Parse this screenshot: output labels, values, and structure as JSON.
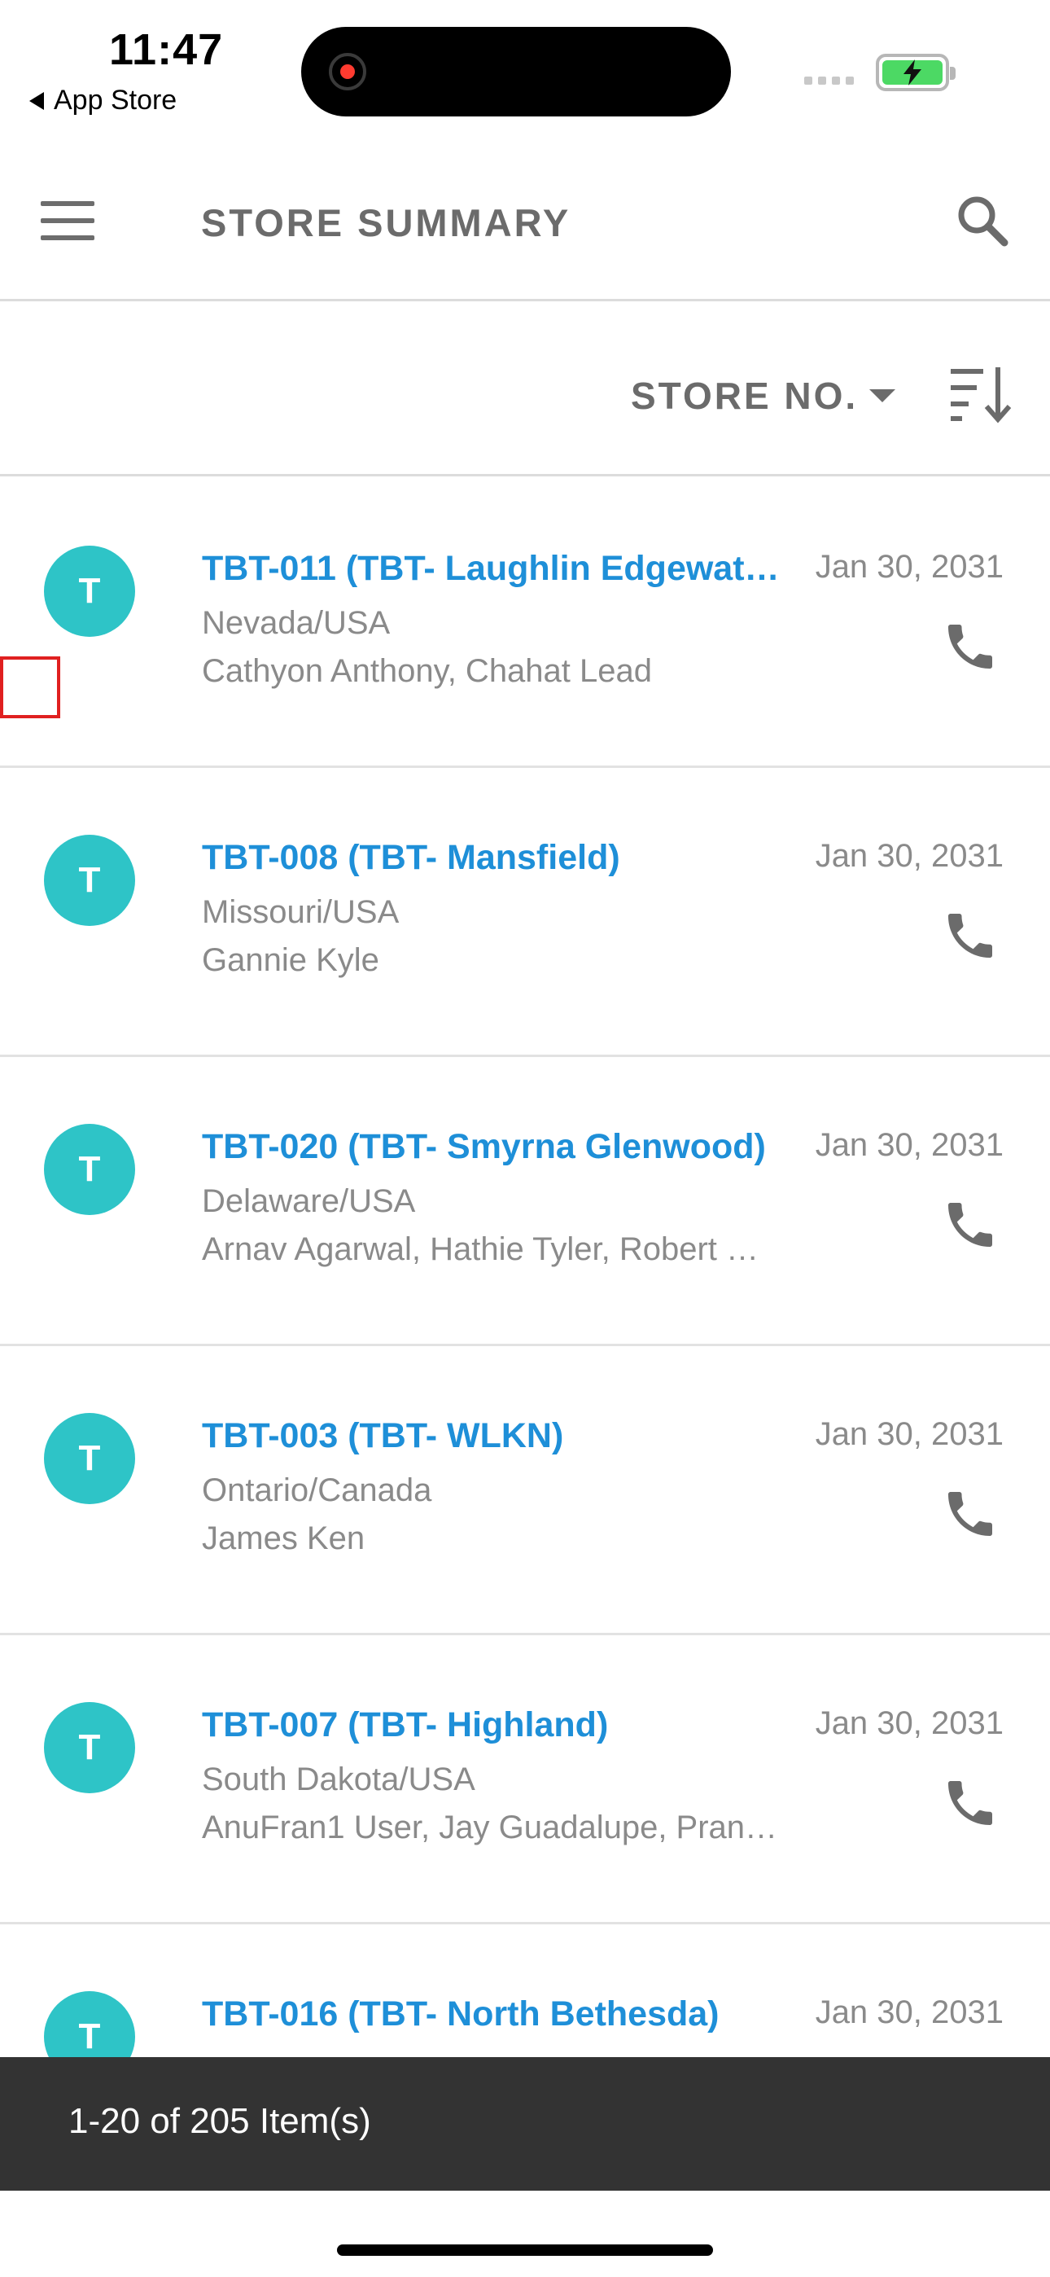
{
  "status_bar": {
    "time": "11:47",
    "back_label": "App Store"
  },
  "header": {
    "title": "STORE SUMMARY",
    "menu_icon": "hamburger-menu-icon",
    "search_icon": "search-icon"
  },
  "sort": {
    "field_label": "STORE NO.",
    "order_icon": "sort-descending-icon"
  },
  "stores": [
    {
      "avatar": "T",
      "name": "TBT-011 (TBT- Laughlin Edgewat…",
      "location": "Nevada/USA",
      "people": "Cathyon Anthony, Chahat Lead",
      "date": "Jan 30, 2031"
    },
    {
      "avatar": "T",
      "name": "TBT-008 (TBT- Mansfield)",
      "location": "Missouri/USA",
      "people": "Gannie Kyle",
      "date": "Jan 30, 2031"
    },
    {
      "avatar": "T",
      "name": "TBT-020 (TBT- Smyrna Glenwood)",
      "location": "Delaware/USA",
      "people": "Arnav Agarwal, Hathie Tyler, Robert …",
      "date": "Jan 30, 2031"
    },
    {
      "avatar": "T",
      "name": "TBT-003 (TBT- WLKN)",
      "location": "Ontario/Canada",
      "people": "James Ken",
      "date": "Jan 30, 2031"
    },
    {
      "avatar": "T",
      "name": "TBT-007 (TBT- Highland)",
      "location": "South Dakota/USA",
      "people": "AnuFran1 User, Jay Guadalupe, Pran…",
      "date": "Jan 30, 2031"
    },
    {
      "avatar": "T",
      "name": "TBT-016 (TBT- North Bethesda)",
      "location": "",
      "people": "",
      "date": "Jan 30, 2031"
    }
  ],
  "pager": {
    "text": "1-20 of 205 Item(s)"
  },
  "colors": {
    "accent_link": "#1e8fd8",
    "avatar_bg": "#2ec4c7",
    "footer_bg": "#333333",
    "selection_outline": "#e02020"
  }
}
